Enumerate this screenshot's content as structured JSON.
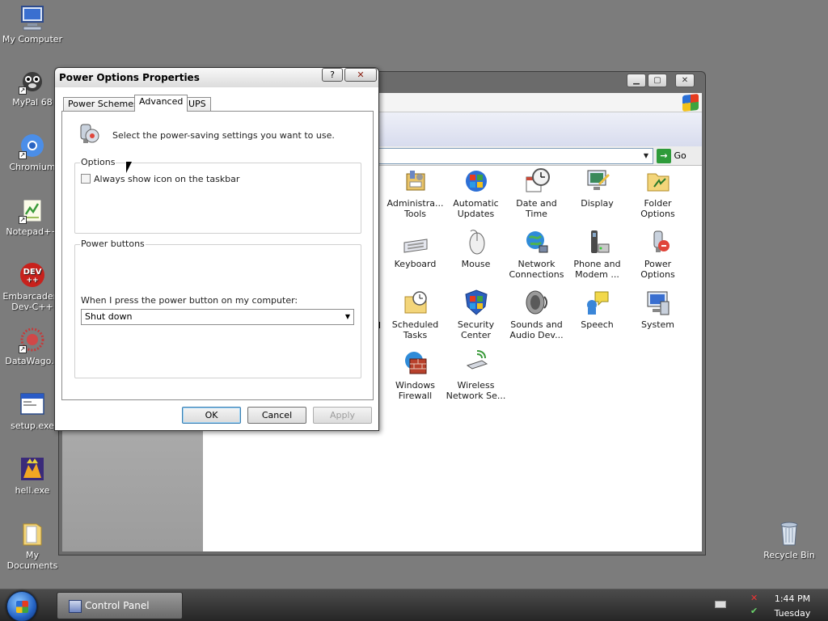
{
  "desktop": {
    "icons": [
      {
        "label": "My Computer",
        "icon": "computer-icon"
      },
      {
        "label": "MyPal 68",
        "icon": "browser-icon"
      },
      {
        "label": "Chromium",
        "icon": "chromium-icon"
      },
      {
        "label": "Notepad++",
        "icon": "notepad-icon"
      },
      {
        "label": "Embarcadero Dev-C++",
        "icon": "devcpp-icon"
      },
      {
        "label": "DataWago...",
        "icon": "datawago-icon"
      },
      {
        "label": "setup.exe",
        "icon": "exe-icon"
      },
      {
        "label": "hell.exe",
        "icon": "exe-icon"
      },
      {
        "label": "My Documents",
        "icon": "folder-icon"
      },
      {
        "label": "Recycle Bin",
        "icon": "recycle-bin-icon"
      }
    ]
  },
  "control_panel": {
    "address_go": "Go",
    "items": [
      {
        "label": "Administra... Tools",
        "icon": "administrative-tools-icon"
      },
      {
        "label": "Automatic Updates",
        "icon": "automatic-updates-icon"
      },
      {
        "label": "Date and Time",
        "icon": "date-time-icon"
      },
      {
        "label": "Display",
        "icon": "display-icon"
      },
      {
        "label": "Folder Options",
        "icon": "folder-options-icon"
      },
      {
        "label": "Keyboard",
        "icon": "keyboard-icon"
      },
      {
        "label": "Mouse",
        "icon": "mouse-icon"
      },
      {
        "label": "Network Connections",
        "icon": "network-icon"
      },
      {
        "label": "Phone and Modem ...",
        "icon": "phone-modem-icon"
      },
      {
        "label": "Power Options",
        "icon": "power-options-icon"
      },
      {
        "label": "Scheduled Tasks",
        "icon": "scheduled-tasks-icon"
      },
      {
        "label": "Security Center",
        "icon": "security-center-icon"
      },
      {
        "label": "Sounds and Audio Dev...",
        "icon": "sounds-icon"
      },
      {
        "label": "Speech",
        "icon": "speech-icon"
      },
      {
        "label": "System",
        "icon": "system-icon"
      },
      {
        "label": "Windows Firewall",
        "icon": "firewall-icon"
      },
      {
        "label": "Wireless Network Se...",
        "icon": "wireless-icon"
      }
    ],
    "partial_letter": "d"
  },
  "dialog": {
    "title": "Power Options Properties",
    "help_glyph": "?",
    "close_glyph": "✕",
    "tabs": [
      {
        "label": "Power Schemes",
        "active": false
      },
      {
        "label": "Advanced",
        "active": true
      },
      {
        "label": "UPS",
        "active": false
      }
    ],
    "intro": "Select the power-saving settings you want to use.",
    "options_group": "Options",
    "checkbox_label": "Always show icon on the taskbar",
    "checkbox_checked": false,
    "power_group": "Power buttons",
    "power_button_label": "When I press the power button on my computer:",
    "power_button_value": "Shut down",
    "ok": "OK",
    "cancel": "Cancel",
    "apply": "Apply"
  },
  "taskbar": {
    "task_label": "Control Panel",
    "time": "1:44 PM",
    "day": "Tuesday"
  }
}
